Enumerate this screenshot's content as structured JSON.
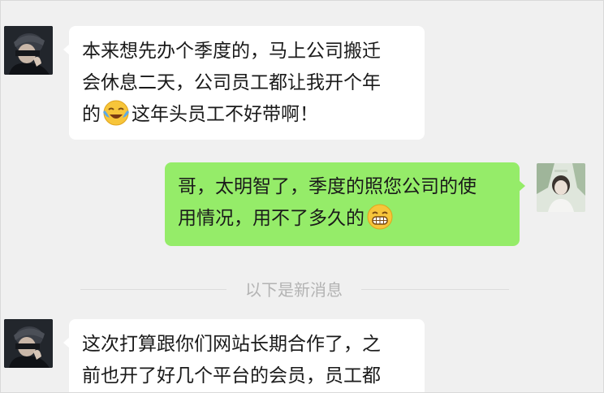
{
  "messages": [
    {
      "side": "incoming",
      "sender": "contact",
      "lines": [
        "本来想先办个季度的，马上公司搬迁",
        "会休息二天，公司员工都让我开个年",
        "的",
        "这年头员工不好带啊！"
      ],
      "emoji": "crying-laughing-emoji"
    },
    {
      "side": "outgoing",
      "sender": "me",
      "lines": [
        "哥，太明智了，季度的照您公司的使",
        "用情况，用不了多久的"
      ],
      "emoji": "grinning-emoji"
    },
    {
      "side": "incoming",
      "sender": "contact",
      "lines": [
        "这次打算跟你们网站长期合作了，之",
        "前也开了好几个平台的会员，员工都"
      ]
    }
  ],
  "divider": {
    "label": "以下是新消息"
  },
  "colors": {
    "background": "#f0f0f0",
    "incoming_bubble": "#ffffff",
    "outgoing_bubble": "#95ec69",
    "divider_text": "#b3b3b3"
  }
}
